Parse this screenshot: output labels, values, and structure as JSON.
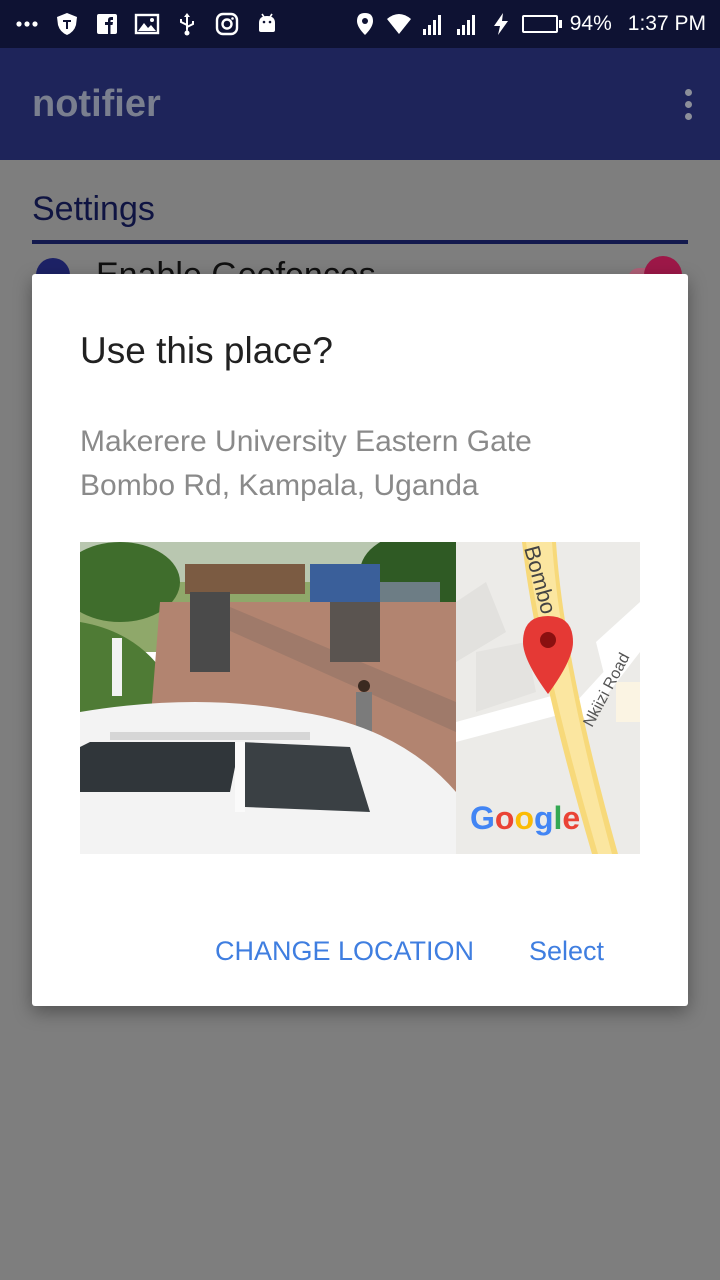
{
  "status_bar": {
    "battery_percent": "94%",
    "battery_level": 0.94,
    "time": "1:37 PM",
    "left_icons": [
      "more-icon",
      "shield-icon",
      "facebook-icon",
      "image-icon",
      "usb-icon",
      "instagram-icon",
      "android-icon"
    ],
    "right_icons": [
      "location-icon",
      "wifi-icon",
      "signal-icon",
      "signal-icon",
      "charging-icon",
      "battery-icon"
    ]
  },
  "app_bar": {
    "title": "notifier",
    "menu_icon": "overflow-menu-icon"
  },
  "background": {
    "section_title": "Settings",
    "pref_label": "Enable Geofences",
    "pref_switch_on": true
  },
  "dialog": {
    "title": "Use this place?",
    "address_line1": "Makerere University Eastern Gate",
    "address_line2": "Bombo Rd, Kampala, Uganda",
    "map": {
      "road_label_main": "Bombo",
      "road_label_side": "Nkiizi Road",
      "logo": "Google"
    },
    "buttons": {
      "change_location": "CHANGE LOCATION",
      "select": "Select"
    }
  },
  "colors": {
    "status_bar": "#0e1233",
    "app_bar": "#1e245a",
    "accent": "#3f7ee0",
    "pin": "#e53935"
  }
}
